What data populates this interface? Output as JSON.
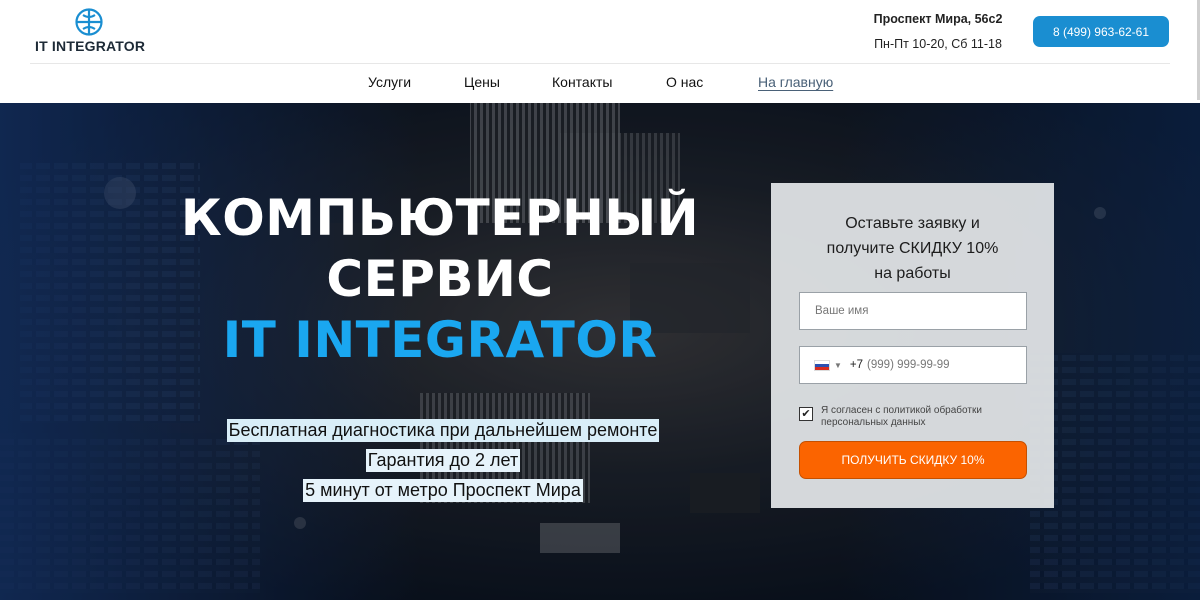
{
  "header": {
    "logo_text": "IT INTEGRATOR",
    "address": "Проспект Мира, 56с2",
    "hours": "Пн-Пт 10-20, Сб 11-18",
    "phone_label": "8 (499) 963-62-61"
  },
  "nav": {
    "items": [
      {
        "label": "Услуги"
      },
      {
        "label": "Цены"
      },
      {
        "label": "Контакты"
      },
      {
        "label": "О нас"
      },
      {
        "label": "На главную"
      }
    ]
  },
  "hero": {
    "title_line1": "КОМПЬЮТЕРНЫЙ",
    "title_line2": "СЕРВИС",
    "title_line3": "IT INTEGRATOR",
    "features": [
      "Бесплатная диагностика при дальнейшем ремонте",
      "Гарантия до 2 лет",
      "5 минут от метро Проспект Мира"
    ]
  },
  "form": {
    "title_line1": "Оставьте заявку и",
    "title_line2": "получите СКИДКУ 10%",
    "title_line3": "на работы",
    "name_placeholder": "Ваше имя",
    "phone_code": "+7",
    "phone_placeholder": "(999) 999-99-99",
    "agree_checked": true,
    "agree_text": "Я согласен с политикой обработки персональных данных",
    "submit_label": "ПОЛУЧИТЬ СКИДКУ 10%"
  },
  "colors": {
    "accent_blue": "#1a8ed1",
    "title_blue": "#1aa7f0",
    "cta_orange": "#fb6400"
  },
  "icons": {
    "logo": "globe-logo-icon",
    "flag": "russia-flag-icon",
    "checkbox": "check-icon"
  }
}
